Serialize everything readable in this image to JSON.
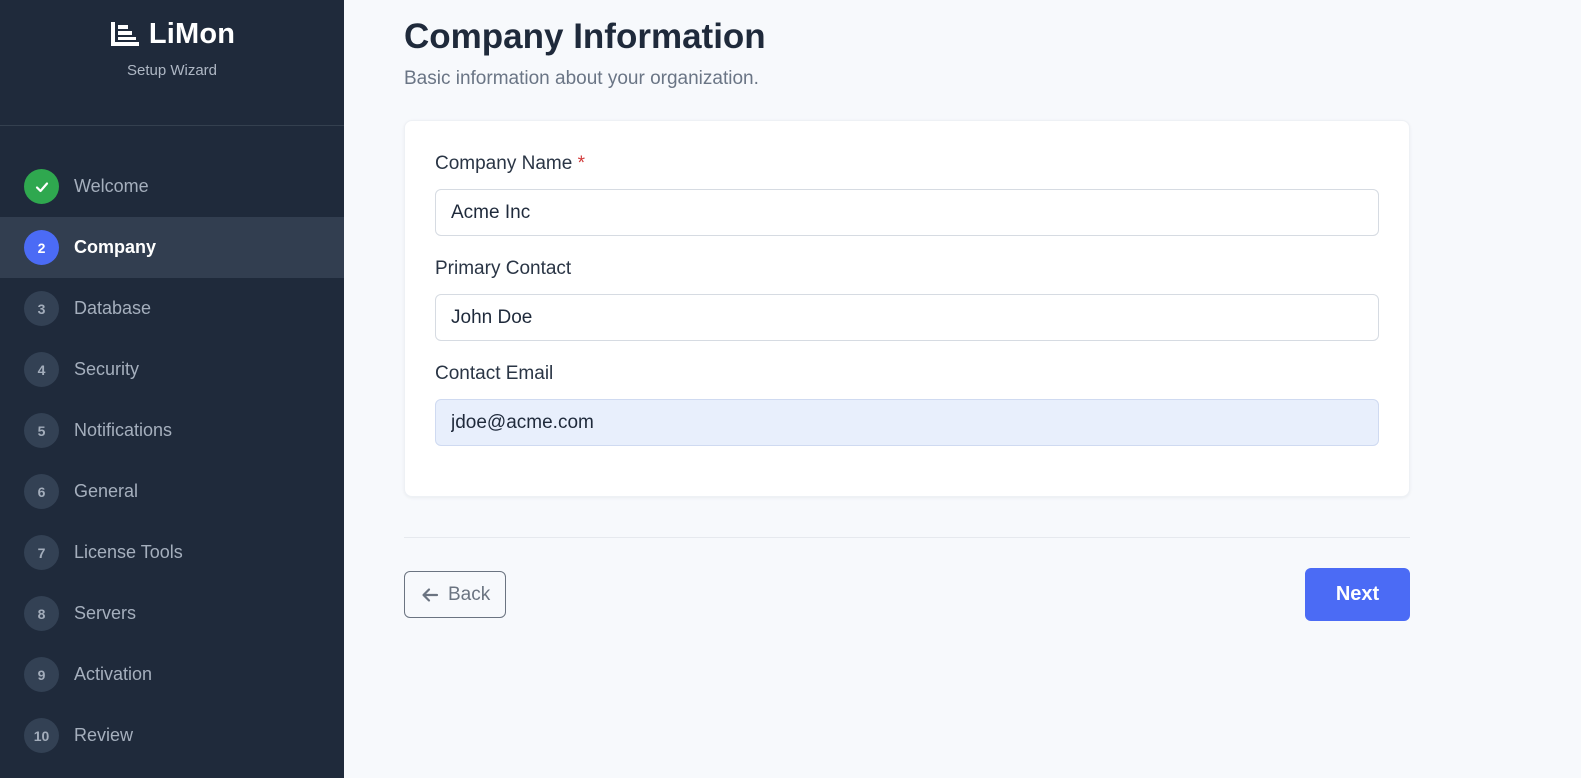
{
  "brand": {
    "name": "LiMon",
    "subtitle": "Setup Wizard"
  },
  "steps": [
    {
      "number": "1",
      "label": "Welcome",
      "status": "done"
    },
    {
      "number": "2",
      "label": "Company",
      "status": "active"
    },
    {
      "number": "3",
      "label": "Database",
      "status": "pending"
    },
    {
      "number": "4",
      "label": "Security",
      "status": "pending"
    },
    {
      "number": "5",
      "label": "Notifications",
      "status": "pending"
    },
    {
      "number": "6",
      "label": "General",
      "status": "pending"
    },
    {
      "number": "7",
      "label": "License Tools",
      "status": "pending"
    },
    {
      "number": "8",
      "label": "Servers",
      "status": "pending"
    },
    {
      "number": "9",
      "label": "Activation",
      "status": "pending"
    },
    {
      "number": "10",
      "label": "Review",
      "status": "pending"
    }
  ],
  "page": {
    "title": "Company Information",
    "subtitle": "Basic information about your organization."
  },
  "form": {
    "company_name": {
      "label": "Company Name",
      "required_mark": "*",
      "value": "Acme Inc"
    },
    "primary_contact": {
      "label": "Primary Contact",
      "value": "John Doe"
    },
    "contact_email": {
      "label": "Contact Email",
      "value": "jdoe@acme.com"
    }
  },
  "actions": {
    "back_label": "Back",
    "next_label": "Next"
  },
  "colors": {
    "sidebar_bg": "#1f2a3b",
    "accent": "#4b6bf5",
    "done": "#2fa84f"
  },
  "icons": {
    "logo": "bar-chart-icon",
    "done": "check-icon",
    "back": "arrow-left-icon"
  }
}
